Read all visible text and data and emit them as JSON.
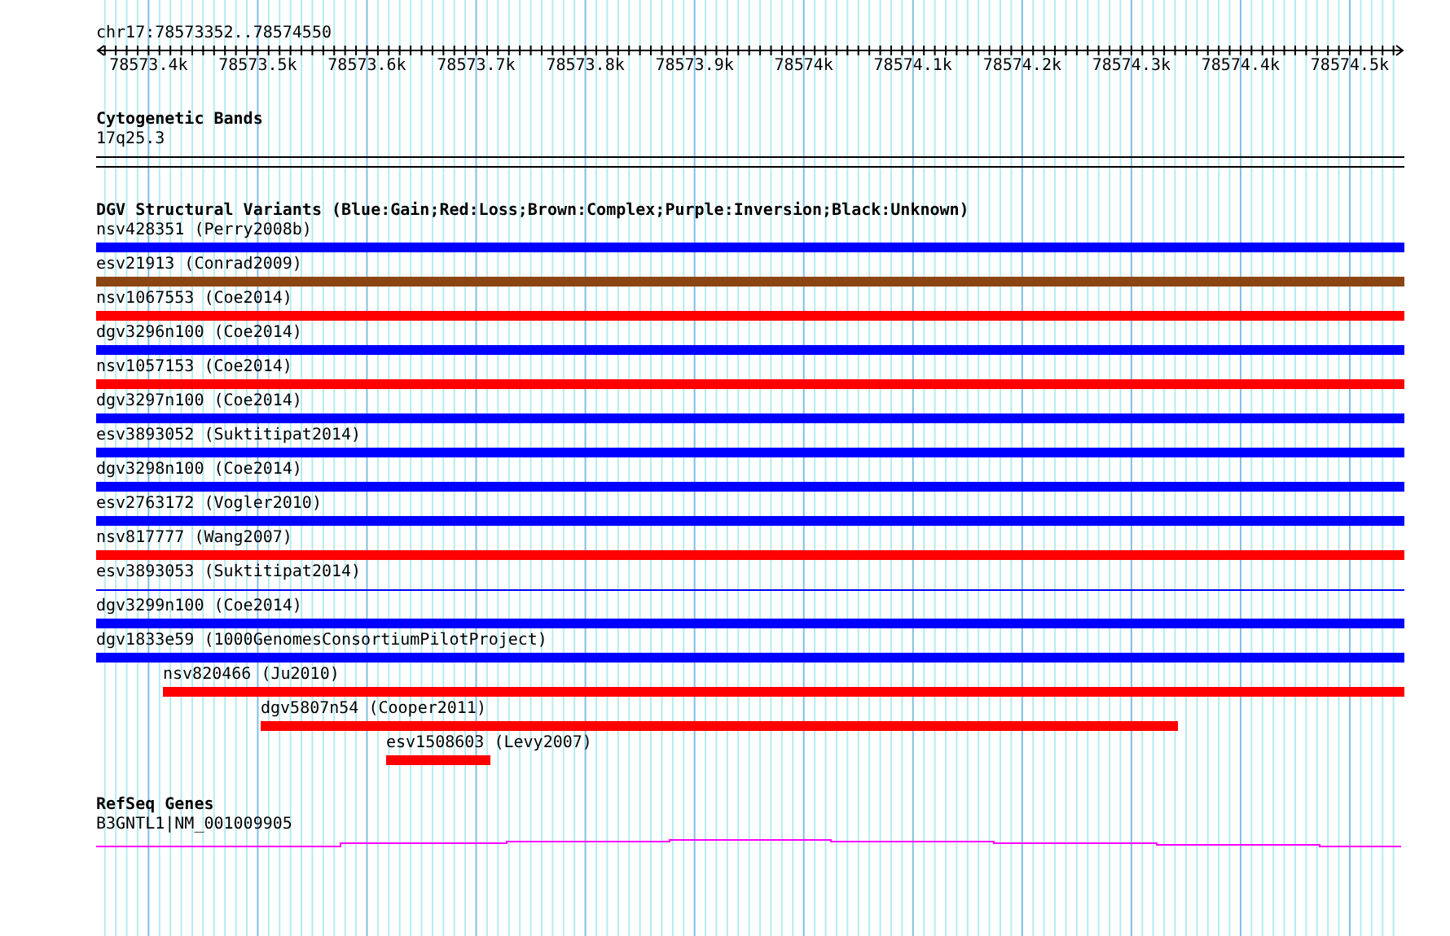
{
  "ruler": {
    "region": "chr17:78573352..78574550",
    "ticks": [
      "78573.4k",
      "78573.5k",
      "78573.6k",
      "78573.7k",
      "78573.8k",
      "78573.9k",
      "78574k",
      "78574.1k",
      "78574.2k",
      "78574.3k",
      "78574.4k",
      "78574.5k"
    ]
  },
  "tracks": [
    {
      "title": "Cytogenetic Bands",
      "kind": "cytoband",
      "features": [
        {
          "label": "17q25.3",
          "kind": "band"
        }
      ]
    },
    {
      "title": "DGV Structural Variants (Blue:Gain;Red:Loss;Brown:Complex;Purple:Inversion;Black:Unknown)",
      "kind": "variants",
      "features": [
        {
          "label": "nsv428351 (Perry2008b)",
          "color": "#0000ff",
          "kind": "bar"
        },
        {
          "label": "esv21913 (Conrad2009)",
          "color": "#8b4513",
          "kind": "bar"
        },
        {
          "label": "nsv1067553 (Coe2014)",
          "color": "#ff0000",
          "kind": "bar"
        },
        {
          "label": "dgv3296n100 (Coe2014)",
          "color": "#0000ff",
          "kind": "bar"
        },
        {
          "label": "nsv1057153 (Coe2014)",
          "color": "#ff0000",
          "kind": "bar"
        },
        {
          "label": "dgv3297n100 (Coe2014)",
          "color": "#0000ff",
          "kind": "bar"
        },
        {
          "label": "esv3893052 (Suktitipat2014)",
          "color": "#0000ff",
          "kind": "bar"
        },
        {
          "label": "dgv3298n100 (Coe2014)",
          "color": "#0000ff",
          "kind": "bar"
        },
        {
          "label": "esv2763172 (Vogler2010)",
          "color": "#0000ff",
          "kind": "bar"
        },
        {
          "label": "nsv817777 (Wang2007)",
          "color": "#ff0000",
          "kind": "bar"
        },
        {
          "label": "esv3893053 (Suktitipat2014)",
          "color": "#0000ff",
          "kind": "line"
        },
        {
          "label": "dgv3299n100 (Coe2014)",
          "color": "#0000ff",
          "kind": "bar"
        },
        {
          "label": "dgv1833e59 (1000GenomesConsortiumPilotProject)",
          "color": "#0000ff",
          "kind": "bar"
        },
        {
          "label": "nsv820466 (Ju2010)",
          "color": "#ff0000",
          "kind": "bar"
        },
        {
          "label": "dgv5807n54 (Cooper2011)",
          "color": "#ff0000",
          "kind": "bar"
        },
        {
          "label": "esv1508603 (Levy2007)",
          "color": "#ff0000",
          "kind": "bar"
        }
      ]
    },
    {
      "title": "RefSeq Genes",
      "kind": "gene",
      "features": [
        {
          "label": "B3GNTL1|NM_001009905",
          "kind": "gene"
        }
      ]
    }
  ]
}
